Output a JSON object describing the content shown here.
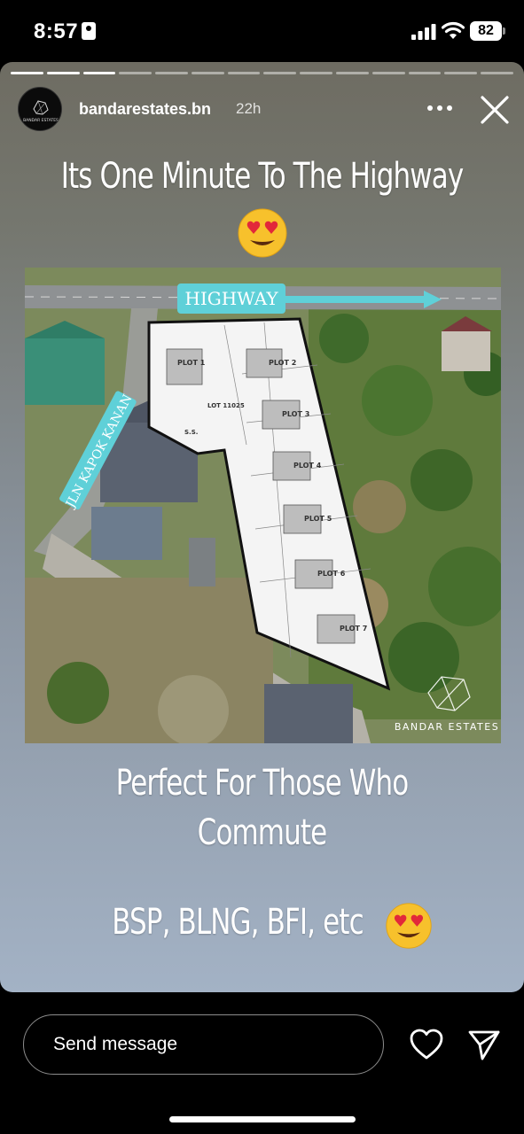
{
  "status_bar": {
    "time": "8:57",
    "battery": "82"
  },
  "story": {
    "progress_total": 14,
    "progress_done": 3,
    "username": "bandarestates.bn",
    "time_ago": "22h",
    "caption_top": "Its One Minute To The Highway",
    "caption_middle_line1": "Perfect For Those Who",
    "caption_middle_line2": "Commute",
    "caption_bottom": "BSP, BLNG, BFI, etc",
    "photo": {
      "highway_label": "HIGHWAY",
      "road_label": "JLN KAPOK KANAN",
      "brand_label": "BANDAR ESTATES",
      "avatar_brand": "BANDAR ESTATES",
      "plot_labels": [
        "PLOT 1",
        "PLOT 2",
        "PLOT 3",
        "PLOT 4",
        "PLOT 5",
        "PLOT 6",
        "PLOT 7"
      ],
      "lot_label": "LOT 11025",
      "ss_label": "S.S."
    }
  },
  "bottom_bar": {
    "message_placeholder": "Send message"
  },
  "icons": {
    "more": "more-horizontal-icon",
    "close": "close-icon",
    "like": "heart-icon",
    "share": "send-icon",
    "emoji": "heart-eyes-emoji"
  }
}
